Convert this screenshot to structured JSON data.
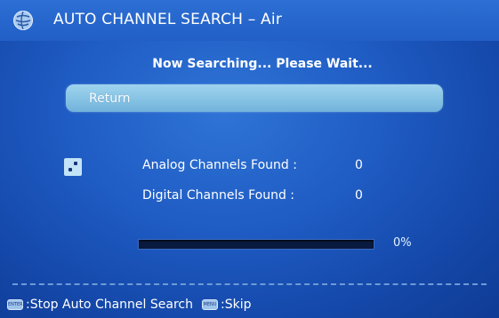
{
  "header": {
    "title": "AUTO CHANNEL SEARCH – Air",
    "logo_icon": "globe-logo-icon"
  },
  "status_text": "Now Searching... Please Wait...",
  "return_button": {
    "label": "Return"
  },
  "results": {
    "icon": "scan-dots-icon",
    "analog_label": "Analog Channels Found :",
    "analog_value": "0",
    "digital_label": "Digital Channels Found :",
    "digital_value": "0"
  },
  "progress": {
    "value_percent": 0,
    "label": "0%"
  },
  "footer": {
    "enter_key": "ENTER",
    "enter_action": ":Stop Auto Channel Search",
    "menu_key": "MENU",
    "menu_action": ":Skip"
  },
  "colors": {
    "background": "#1f5cc4",
    "button": "#86c3e4",
    "progress_track": "#0a1a3f",
    "progress_fill": "#7dd3ff"
  }
}
